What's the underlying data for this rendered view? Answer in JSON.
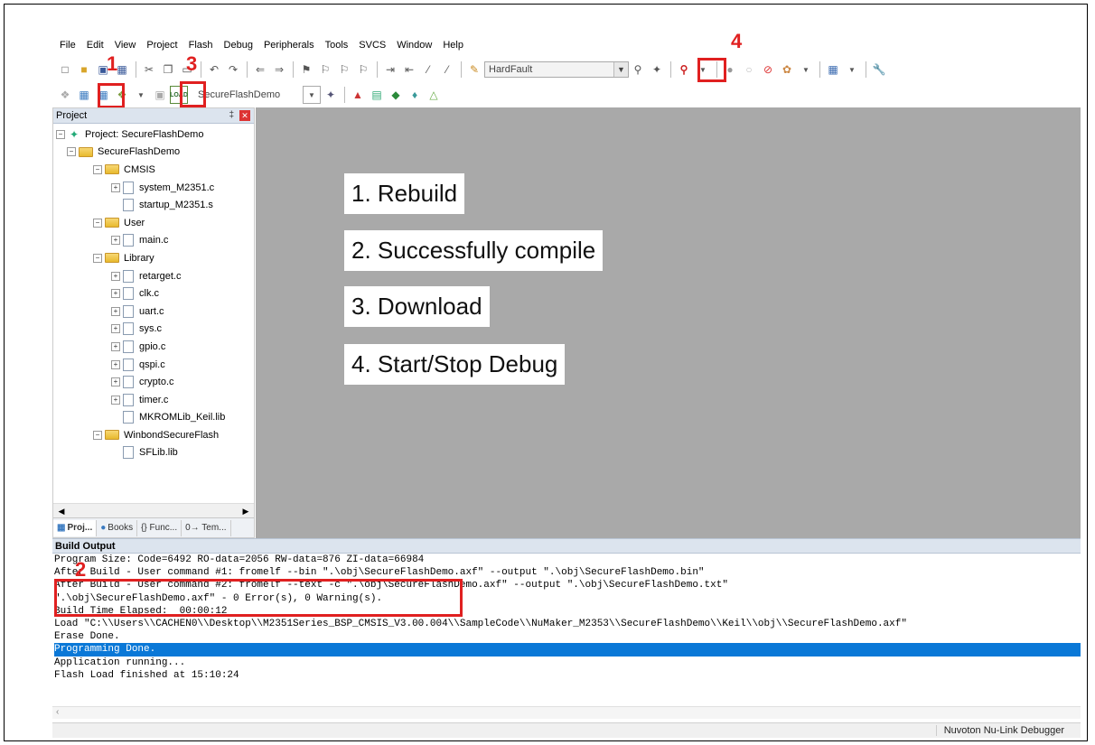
{
  "menu": [
    "File",
    "Edit",
    "View",
    "Project",
    "Flash",
    "Debug",
    "Peripherals",
    "Tools",
    "SVCS",
    "Window",
    "Help"
  ],
  "toolbar": {
    "find_combo_value": "HardFault",
    "target_combo_value": "SecureFlashDemo",
    "load_label": "LOAD"
  },
  "markers": {
    "m1": "1",
    "m2": "2",
    "m3": "3",
    "m4": "4"
  },
  "project_panel": {
    "title": "Project",
    "tree": [
      {
        "label": "Project: SecureFlashDemo",
        "type": "project",
        "expanded": true
      },
      {
        "label": "SecureFlashDemo",
        "type": "folder",
        "expanded": true
      },
      {
        "label": "CMSIS",
        "type": "folder",
        "expanded": true
      },
      {
        "label": "system_M2351.c",
        "type": "file",
        "expandable": true
      },
      {
        "label": "startup_M2351.s",
        "type": "file",
        "expandable": false
      },
      {
        "label": "User",
        "type": "folder",
        "expanded": true
      },
      {
        "label": "main.c",
        "type": "file",
        "expandable": true
      },
      {
        "label": "Library",
        "type": "folder",
        "expanded": true
      },
      {
        "label": "retarget.c",
        "type": "file",
        "expandable": true
      },
      {
        "label": "clk.c",
        "type": "file",
        "expandable": true
      },
      {
        "label": "uart.c",
        "type": "file",
        "expandable": true
      },
      {
        "label": "sys.c",
        "type": "file",
        "expandable": true
      },
      {
        "label": "gpio.c",
        "type": "file",
        "expandable": true
      },
      {
        "label": "qspi.c",
        "type": "file",
        "expandable": true
      },
      {
        "label": "crypto.c",
        "type": "file",
        "expandable": true
      },
      {
        "label": "timer.c",
        "type": "file",
        "expandable": true
      },
      {
        "label": "MKROMLib_Keil.lib",
        "type": "file",
        "expandable": false
      },
      {
        "label": "WinbondSecureFlash",
        "type": "folder",
        "expanded": true
      },
      {
        "label": "SFLib.lib",
        "type": "file",
        "expandable": false
      }
    ],
    "tabs": [
      "Proj...",
      "Books",
      "{} Func...",
      "0→ Tem..."
    ]
  },
  "callouts": [
    "1. Rebuild",
    "2. Successfully compile",
    "3. Download",
    "4. Start/Stop Debug"
  ],
  "build_output": {
    "title": "Build Output",
    "lines": [
      "Program Size: Code=6492 RO-data=2056 RW-data=876 ZI-data=66984",
      "After Build - User command #1: fromelf --bin \".\\obj\\SecureFlashDemo.axf\" --output \".\\obj\\SecureFlashDemo.bin\"",
      "After Build - User command #2: fromelf --text -c \".\\obj\\SecureFlashDemo.axf\" --output \".\\obj\\SecureFlashDemo.txt\"",
      "\".\\obj\\SecureFlashDemo.axf\" - 0 Error(s), 0 Warning(s).",
      "Build Time Elapsed:  00:00:12",
      "Load \"C:\\\\Users\\\\CACHEN0\\\\Desktop\\\\M2351Series_BSP_CMSIS_V3.00.004\\\\SampleCode\\\\NuMaker_M2353\\\\SecureFlashDemo\\\\Keil\\\\obj\\\\SecureFlashDemo.axf\"",
      "Erase Done.",
      "Programming Done.",
      "Application running...",
      "Flash Load finished at 15:10:24"
    ],
    "selected_index": 7
  },
  "status_bar": {
    "debugger": "Nuvoton Nu-Link Debugger"
  },
  "colors": {
    "highlight": "#e02020",
    "selection": "#0a78d7",
    "editor_bg": "#a9a9a9"
  }
}
